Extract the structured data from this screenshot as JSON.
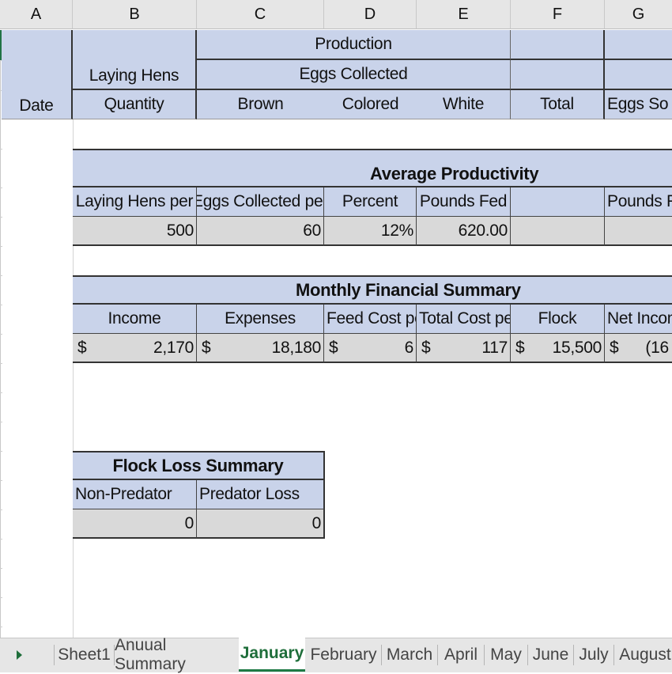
{
  "column_headers": [
    "A",
    "B",
    "C",
    "D",
    "E",
    "F",
    "G"
  ],
  "production_header": {
    "production_label": "Production",
    "eggs_collected_label": "Eggs Collected",
    "laying_hens_label": "Laying Hens",
    "date_label": "Date",
    "quantity_label": "Quantity",
    "brown_label": "Brown",
    "colored_label": "Colored",
    "white_label": "White",
    "total_label": "Total",
    "eggs_sold_label": "Eggs So"
  },
  "average_productivity": {
    "title": "Average Productivity",
    "headers": [
      "Laying Hens per",
      "Eggs Collected per",
      "Percent",
      "Pounds Fed",
      "",
      "Pounds Fe"
    ],
    "values": [
      "500",
      "60",
      "12%",
      "620.00",
      "",
      ""
    ]
  },
  "monthly_financial_summary": {
    "title": "Monthly Financial Summary",
    "headers": [
      "Income",
      "Expenses",
      "Feed Cost per",
      "Total Cost per",
      "Flock",
      "Net Incom"
    ],
    "currency_symbol": "$",
    "values": [
      "2,170",
      "18,180",
      "6",
      "117",
      "15,500",
      "(16"
    ]
  },
  "flock_loss_summary": {
    "title": "Flock Loss Summary",
    "headers": [
      "Non-Predator",
      "Predator Loss"
    ],
    "values": [
      "0",
      "0"
    ]
  },
  "sheet_tabs": {
    "scroll_icon": "triangle-right",
    "tabs": [
      "Sheet1",
      "Anuual Summary",
      "January",
      "February",
      "March",
      "April",
      "May",
      "June",
      "July",
      "August"
    ],
    "active": "January"
  },
  "colors": {
    "header_fill": "#c9d3ea",
    "value_fill": "#d9d9d9",
    "active_tab": "#1e6e3a"
  }
}
